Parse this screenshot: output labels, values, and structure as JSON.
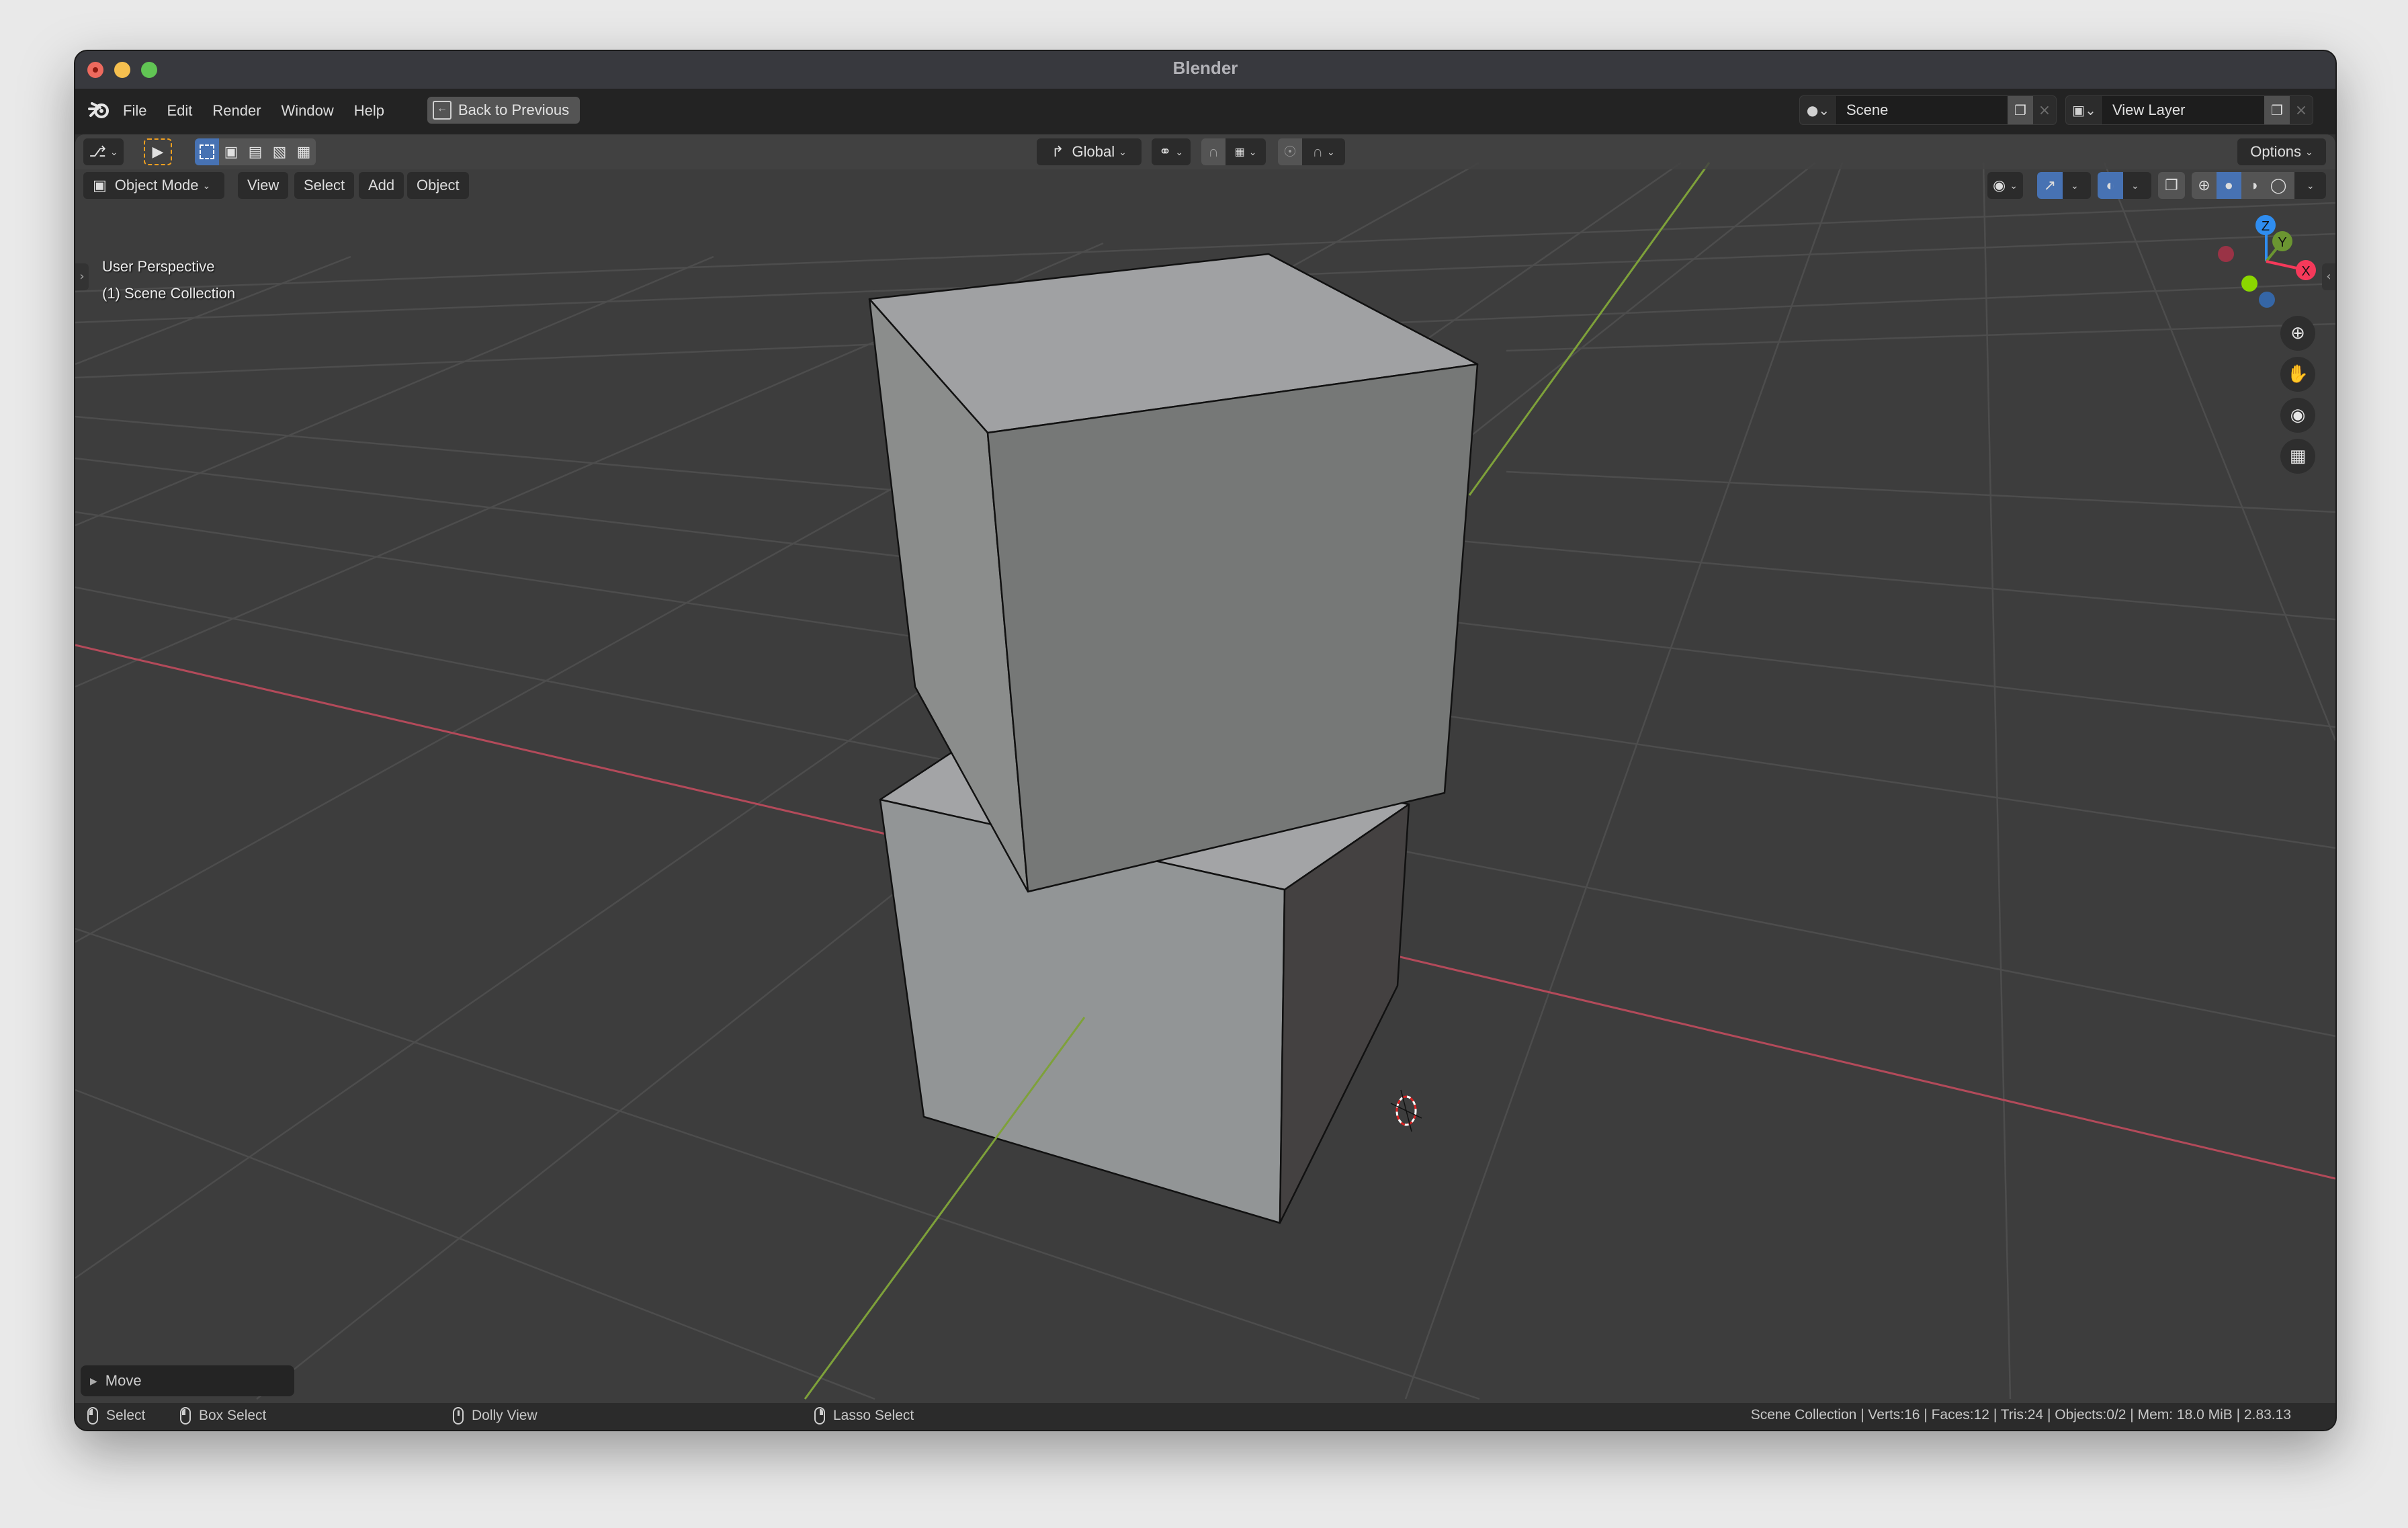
{
  "window": {
    "title": "Blender",
    "controls": [
      "close",
      "minimize",
      "maximize"
    ]
  },
  "topbar": {
    "logo_icon": "blender-logo-icon",
    "menu": [
      "File",
      "Edit",
      "Render",
      "Window",
      "Help"
    ],
    "back_button": {
      "label": "Back to Previous",
      "icon": "back-to-previous-icon"
    },
    "scene": {
      "icon": "scene-icon",
      "value": "Scene",
      "copy_icon": "duplicate-icon",
      "remove_icon": "close-icon"
    },
    "view_layer": {
      "icon": "view-layer-icon",
      "value": "View Layer",
      "copy_icon": "duplicate-icon",
      "remove_icon": "close-icon"
    }
  },
  "tool_header": {
    "transform_orientation": {
      "icon": "orientation-icon",
      "value": "Global"
    },
    "pivot_icon": "pivot-point-icon",
    "snap_icon": "snap-magnet-icon",
    "snap_increment_icon": "snap-increment-icon",
    "proportional_icon": "proportional-edit-icon",
    "falloff_icon": "falloff-curve-icon",
    "options_label": "Options",
    "select_modes": [
      "set",
      "extend",
      "subtract",
      "invert",
      "intersect"
    ],
    "active_select_mode": "set"
  },
  "view_header": {
    "mode": "Object Mode",
    "menus": [
      "View",
      "Select",
      "Add",
      "Object"
    ],
    "shading_modes": [
      "wireframe",
      "solid",
      "material-preview",
      "rendered"
    ],
    "active_shading": "solid"
  },
  "viewport": {
    "perspective_label": "User Perspective",
    "collection_label": "(1) Scene Collection",
    "gizmo_axes": [
      "X",
      "Y",
      "Z"
    ],
    "nav_buttons": [
      "zoom-icon",
      "pan-hand-icon",
      "camera-icon",
      "grid-ortho-icon"
    ],
    "colors": {
      "x_axis": "#b34a5a",
      "y_axis": "#7ea13a",
      "gizmo_x": "#f5395a",
      "gizmo_y": "#6b9531",
      "gizmo_z": "#2f8df0",
      "gizmo_neg_x": "#9a3346",
      "gizmo_neg_y": "#8bd600",
      "gizmo_neg_z": "#3566a6",
      "select_active": "#4772b3"
    }
  },
  "last_operator": {
    "label": "Move"
  },
  "statusbar": {
    "hints": [
      {
        "mouse": "left",
        "label": "Select"
      },
      {
        "mouse": "left-drag",
        "label": "Box Select"
      },
      {
        "mouse": "middle",
        "label": "Dolly View"
      },
      {
        "mouse": "right-drag",
        "label": "Lasso Select"
      }
    ],
    "stats": "Scene Collection | Verts:16 | Faces:12 | Tris:24 | Objects:0/2 | Mem: 18.0 MiB | 2.83.13"
  }
}
